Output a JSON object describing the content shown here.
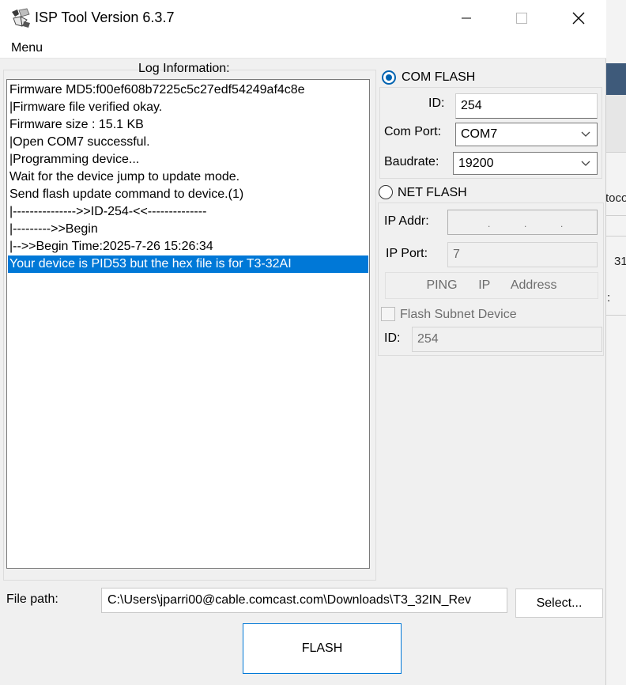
{
  "window": {
    "title": "ISP Tool Version 6.3.7"
  },
  "menu": {
    "label": "Menu"
  },
  "log": {
    "title": "Log Information:",
    "lines": [
      "Firmware MD5:f00ef608b7225c5c27edf54249af4c8e",
      "|Firmware file verified okay.",
      "Firmware size : 15.1 KB",
      "|Open COM7 successful.",
      "|Programming device...",
      "Wait for the device jump to update mode.",
      "Send flash update command to device.(1)",
      "|--------------->>ID-254-<<--------------",
      "|--------->>Begin",
      "|-->>Begin Time:2025-7-26 15:26:34",
      "Your device is PID53   but the hex file is for T3-32AI"
    ],
    "selected_index": 10
  },
  "com_flash": {
    "label": "COM FLASH",
    "selected": true,
    "id_label": "ID:",
    "id_value": "254",
    "port_label": "Com Port:",
    "port_value": "COM7",
    "baud_label": "Baudrate:",
    "baud_value": "19200"
  },
  "net_flash": {
    "label": "NET FLASH",
    "selected": false,
    "ip_addr_label": "IP Addr:",
    "ip_port_label": "IP Port:",
    "ip_port_value": "7",
    "ping_label": "PING      IP      Address",
    "subnet_label": "Flash Subnet Device",
    "subnet_checked": false,
    "id_label": "ID:",
    "id_value": "254"
  },
  "file": {
    "label": "File path:",
    "path": "C:\\Users\\jparri00@cable.comcast.com\\Downloads\\T3_32IN_Rev",
    "select_label": "Select..."
  },
  "flash_button": {
    "label": "FLASH"
  },
  "background": {
    "peek_text_1": "toco",
    "peek_text_2": "31",
    "peek_text_3": ":"
  },
  "colors": {
    "accent": "#0078d7",
    "selection": "#0078d7",
    "window_bg": "#f0f0f0"
  }
}
